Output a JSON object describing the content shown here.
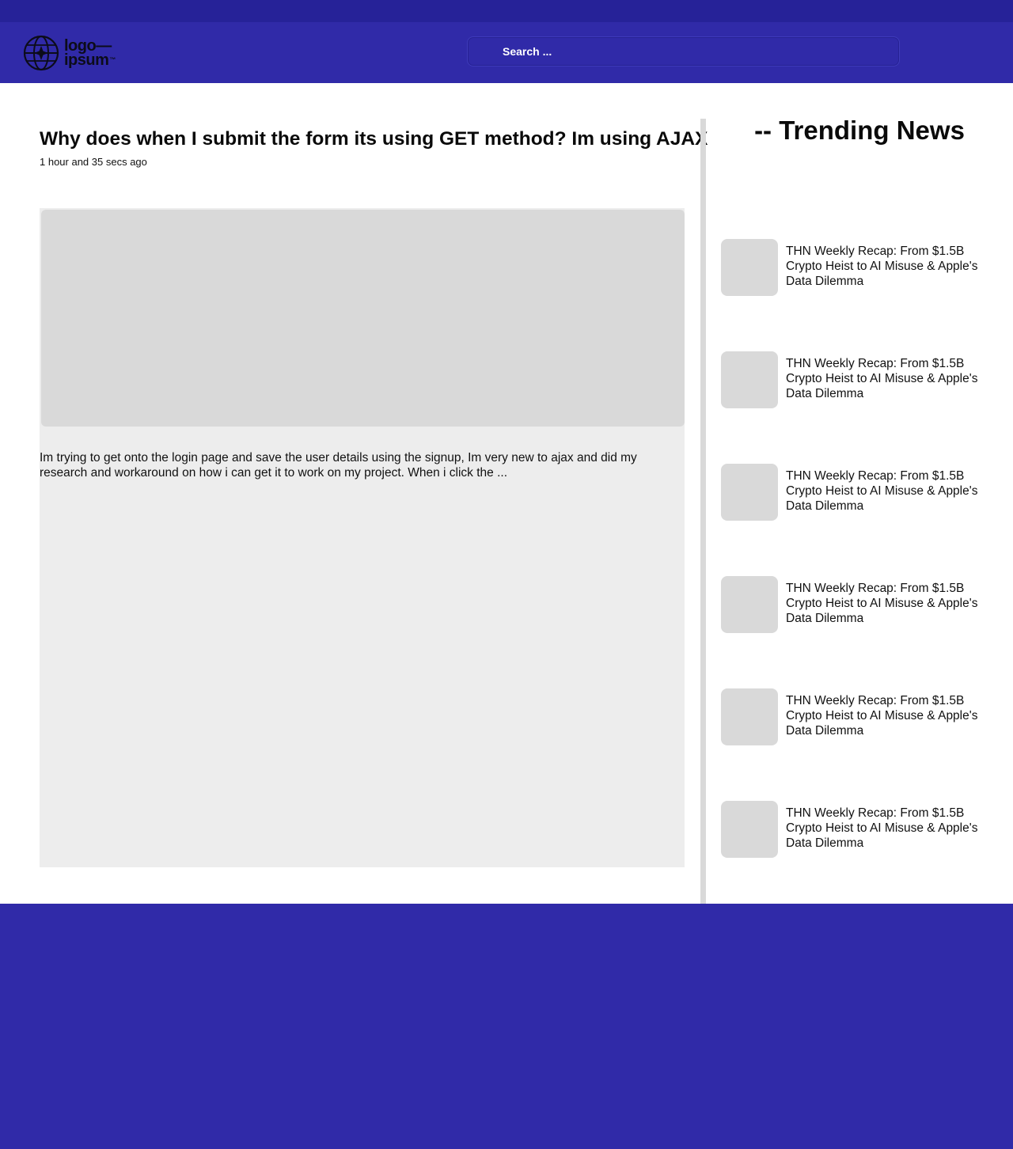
{
  "header": {
    "logo": {
      "line1": "logo—",
      "line2": "ipsum",
      "mark_icon": "globe-star-icon"
    },
    "search": {
      "placeholder": "Search ..."
    }
  },
  "article": {
    "title": "Why does when I submit the form its using GET method? Im using AJAX",
    "time": "1 hour and 35 secs ago",
    "excerpt": "Im trying to get onto the login page and save the user details using the signup, Im very new to ajax and did my research and workaround on how i can get it to work on my project. When i click the ..."
  },
  "sidebar": {
    "title": "-- Trending News",
    "items": [
      {
        "title": "THN Weekly Recap: From $1.5B Crypto Heist to AI Misuse & Apple's Data Dilemma"
      },
      {
        "title": "THN Weekly Recap: From $1.5B Crypto Heist to AI Misuse & Apple's Data Dilemma"
      },
      {
        "title": "THN Weekly Recap: From $1.5B Crypto Heist to AI Misuse & Apple's Data Dilemma"
      },
      {
        "title": "THN Weekly Recap: From $1.5B Crypto Heist to AI Misuse & Apple's Data Dilemma"
      },
      {
        "title": "THN Weekly Recap: From $1.5B Crypto Heist to AI Misuse & Apple's Data Dilemma"
      },
      {
        "title": "THN Weekly Recap: From $1.5B Crypto Heist to AI Misuse & Apple's Data Dilemma"
      }
    ]
  },
  "colors": {
    "topbar": "#262298",
    "header": "#302aa8",
    "footer": "#302aa8",
    "placeholder_gray": "#d9d9d9",
    "card_gray": "#ededed"
  }
}
